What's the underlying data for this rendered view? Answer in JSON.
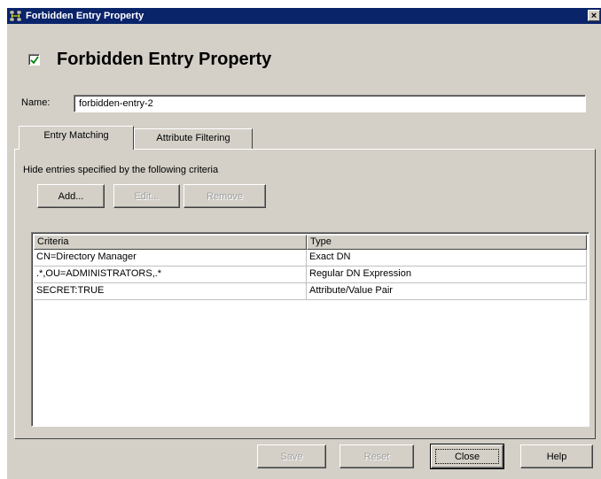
{
  "window": {
    "title": "Forbidden Entry Property",
    "close_glyph": "×",
    "icon": "network-servers-icon"
  },
  "header": {
    "checked": true,
    "title": "Forbidden Entry Property"
  },
  "name": {
    "label": "Name:",
    "value": "forbidden-entry-2"
  },
  "tabs": [
    {
      "label": "Entry Matching",
      "active": true
    },
    {
      "label": "Attribute Filtering",
      "active": false
    }
  ],
  "panel": {
    "description": "Hide entries specified by the following criteria",
    "buttons": {
      "add": "Add...",
      "edit": "Edit...",
      "remove": "Remove"
    }
  },
  "table": {
    "columns": [
      "Criteria",
      "Type"
    ],
    "rows": [
      [
        "CN=Directory Manager",
        "Exact DN"
      ],
      [
        ".*,OU=ADMINISTRATORS,.*",
        "Regular DN Expression"
      ],
      [
        "SECRET:TRUE",
        "Attribute/Value Pair"
      ]
    ]
  },
  "footer": {
    "save": "Save",
    "reset": "Reset",
    "close": "Close",
    "help": "Help"
  },
  "colors": {
    "titlebar": "#0a246a",
    "face": "#d4d0c8",
    "check": "#008000"
  }
}
